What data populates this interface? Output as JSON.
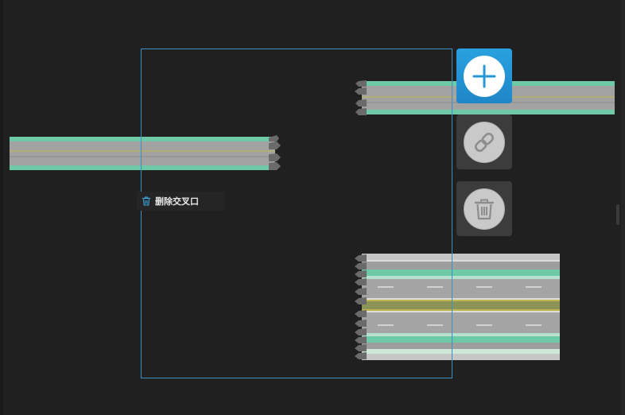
{
  "canvas": {
    "background": "#202020",
    "selection_color": "#3b8fc4"
  },
  "context_menu": {
    "delete_intersection_label": "删除交叉口",
    "icon": "trash-icon"
  },
  "toolbar": {
    "add_icon": "plus-icon",
    "link_icon": "link-icon",
    "delete_icon": "trash-icon",
    "accent": "#2596d8"
  },
  "road_colors": {
    "asphalt": "#a2a2a2",
    "edge_line": "#6ec9a6",
    "center_line": "#c4b54a",
    "median": "#8a9456",
    "shoulder": "#c6c6c6",
    "lane_dash": "#ffffff"
  }
}
